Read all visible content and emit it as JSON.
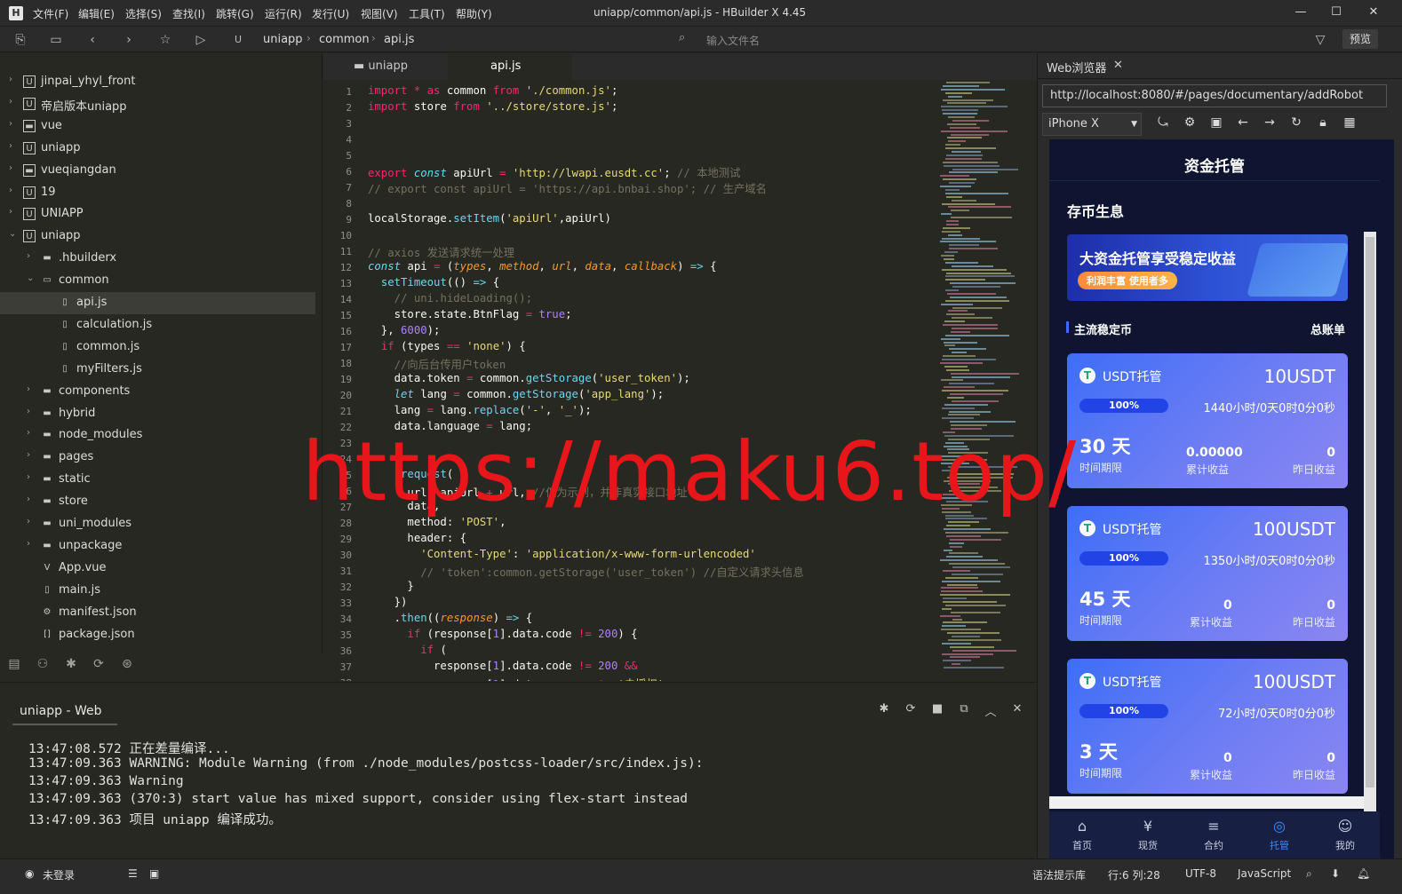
{
  "titlebar": {
    "logo": "H",
    "menus": [
      "文件(F)",
      "编辑(E)",
      "选择(S)",
      "查找(I)",
      "跳转(G)",
      "运行(R)",
      "发行(U)",
      "视图(V)",
      "工具(T)",
      "帮助(Y)"
    ],
    "window_title": "uniapp/common/api.js - HBuilder X 4.45",
    "min": "—",
    "max": "☐",
    "close": "✕"
  },
  "toolbar": {
    "breadcrumb": [
      "uniapp",
      "common",
      "api.js"
    ],
    "file_search_placeholder": "输入文件名",
    "preview": "预览"
  },
  "sidebar": {
    "items": [
      {
        "label": "jinpai_yhyl_front",
        "arrow": "›",
        "icon": "U"
      },
      {
        "label": "帝启版本uniapp",
        "arrow": "›",
        "icon": "U"
      },
      {
        "label": "vue",
        "arrow": "›",
        "icon": "▬"
      },
      {
        "label": "uniapp",
        "arrow": "›",
        "icon": "U"
      },
      {
        "label": "vueqiangdan",
        "arrow": "›",
        "icon": "▬"
      },
      {
        "label": "19",
        "arrow": "›",
        "icon": "U"
      },
      {
        "label": "UNIAPP",
        "arrow": "›",
        "icon": "U"
      },
      {
        "label": "uniapp",
        "arrow": "⌄",
        "icon": "U"
      },
      {
        "label": ".hbuilderx",
        "arrow": "›",
        "icon": "▬"
      },
      {
        "label": "common",
        "arrow": "⌄",
        "icon": "▭"
      },
      {
        "label": "api.js",
        "arrow": "",
        "icon": "▯"
      },
      {
        "label": "calculation.js",
        "arrow": "",
        "icon": "▯"
      },
      {
        "label": "common.js",
        "arrow": "",
        "icon": "▯"
      },
      {
        "label": "myFilters.js",
        "arrow": "",
        "icon": "▯"
      },
      {
        "label": "components",
        "arrow": "›",
        "icon": "▬"
      },
      {
        "label": "hybrid",
        "arrow": "›",
        "icon": "▬"
      },
      {
        "label": "node_modules",
        "arrow": "›",
        "icon": "▬"
      },
      {
        "label": "pages",
        "arrow": "›",
        "icon": "▬"
      },
      {
        "label": "static",
        "arrow": "›",
        "icon": "▬"
      },
      {
        "label": "store",
        "arrow": "›",
        "icon": "▬"
      },
      {
        "label": "uni_modules",
        "arrow": "›",
        "icon": "▬"
      },
      {
        "label": "unpackage",
        "arrow": "›",
        "icon": "▬"
      },
      {
        "label": "App.vue",
        "arrow": "",
        "icon": "V"
      },
      {
        "label": "main.js",
        "arrow": "",
        "icon": "▯"
      },
      {
        "label": "manifest.json",
        "arrow": "",
        "icon": "⚙"
      },
      {
        "label": "package.json",
        "arrow": "",
        "icon": "[]"
      }
    ]
  },
  "editor": {
    "tabs": [
      "uniapp",
      "api.js"
    ],
    "watermark": "https://maku6.top/"
  },
  "console": {
    "tab": "uniapp - Web",
    "lines": [
      "13:47:08.572 正在差量编译...",
      "13:47:09.363 WARNING: Module Warning (from ./node_modules/postcss-loader/src/index.js):",
      "13:47:09.363 Warning",
      "13:47:09.363 (370:3) start value has mixed support, consider using flex-start instead",
      "13:47:09.363 项目 uniapp 编译成功。"
    ]
  },
  "status": {
    "login": "未登录",
    "hint": "语法提示库",
    "position": "行:6  列:28",
    "encoding": "UTF-8",
    "lang": "JavaScript"
  },
  "browser": {
    "tab": "Web浏览器",
    "url": "http://localhost:8080/#/pages/documentary/addRobot",
    "device": "iPhone X",
    "app": {
      "title": "资金托管",
      "subtitle": "存币生息",
      "banner_title": "大资金托管享受稳定收益",
      "banner_badge": "利润丰富 使用者多",
      "section_title": "主流稳定币",
      "total": "总账单",
      "cards": [
        {
          "name": "USDT托管",
          "amount": "10USDT",
          "percent": "100%",
          "duration": "1440小时/0天0时0分0秒",
          "days": "30 天",
          "days_label": "时间期限",
          "earn": "0.00000",
          "earn_label": "累计收益",
          "yday": "0",
          "yday_label": "昨日收益"
        },
        {
          "name": "USDT托管",
          "amount": "100USDT",
          "percent": "100%",
          "duration": "1350小时/0天0时0分0秒",
          "days": "45 天",
          "days_label": "时间期限",
          "earn": "0",
          "earn_label": "累计收益",
          "yday": "0",
          "yday_label": "昨日收益"
        },
        {
          "name": "USDT托管",
          "amount": "100USDT",
          "percent": "100%",
          "duration": "72小时/0天0时0分0秒",
          "days": "3 天",
          "days_label": "时间期限",
          "earn": "0",
          "earn_label": "累计收益",
          "yday": "0",
          "yday_label": "昨日收益"
        }
      ],
      "nav": [
        {
          "label": "首页",
          "icon": "⌂"
        },
        {
          "label": "现货",
          "icon": "¥"
        },
        {
          "label": "合约",
          "icon": "≡"
        },
        {
          "label": "托管",
          "icon": "◎"
        },
        {
          "label": "我的",
          "icon": "☺"
        }
      ]
    }
  }
}
